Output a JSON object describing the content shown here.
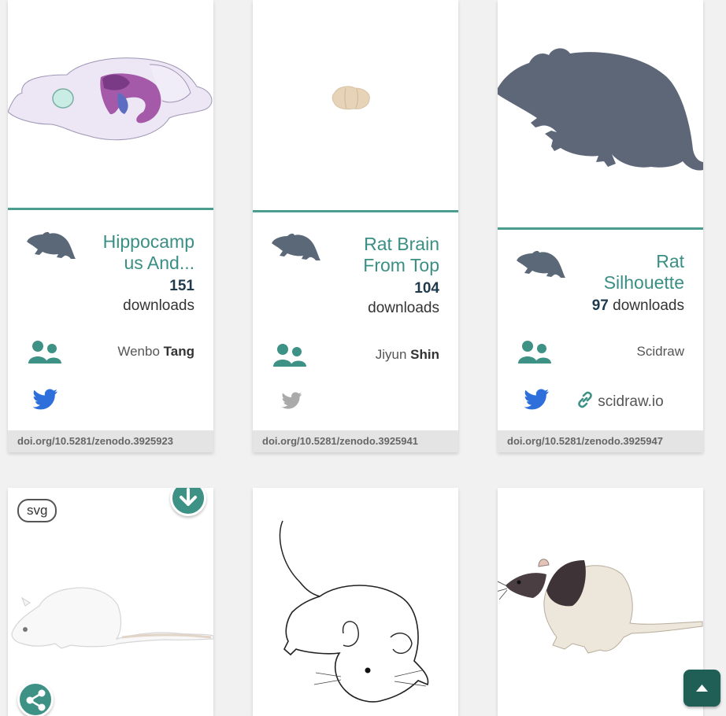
{
  "cards": [
    {
      "title": "Hippocamp us And...",
      "title_line1": "Hippocamp",
      "title_line2": "us And...",
      "downloads_count": "151",
      "downloads_label": "downloads",
      "author_first": "Wenbo",
      "author_last": "Tang",
      "twitter_active": true,
      "doi": "doi.org/10.5281/zenodo.3925923",
      "species_icon": "rat-icon"
    },
    {
      "title": "Rat Brain From Top",
      "title_line1": "Rat Brain",
      "title_line2": "From Top",
      "downloads_count": "104",
      "downloads_label": "downloads",
      "author_first": "Jiyun",
      "author_last": "Shin",
      "twitter_active": false,
      "doi": "doi.org/10.5281/zenodo.3925941",
      "species_icon": "rat-icon"
    },
    {
      "title": "Rat Silhouette",
      "title_line1": "Rat",
      "title_line2": "Silhouette",
      "downloads_count": "97",
      "downloads_label": "downloads",
      "author": "Scidraw",
      "twitter_active": true,
      "link_text": "scidraw.io",
      "doi": "doi.org/10.5281/zenodo.3925947",
      "species_icon": "rat-icon"
    }
  ],
  "row2": {
    "badge": "svg",
    "download_icon": "arrow-down-icon",
    "share_icon": "share-icon"
  },
  "back_to_top_icon": "caret-up-icon",
  "colors": {
    "accent": "#4a9d8f",
    "title": "#3a8f84",
    "twitter": "#2f6fdc",
    "twitter_inactive": "#aaaaaa",
    "species": "#5b6878",
    "button": "#1f5f55"
  }
}
